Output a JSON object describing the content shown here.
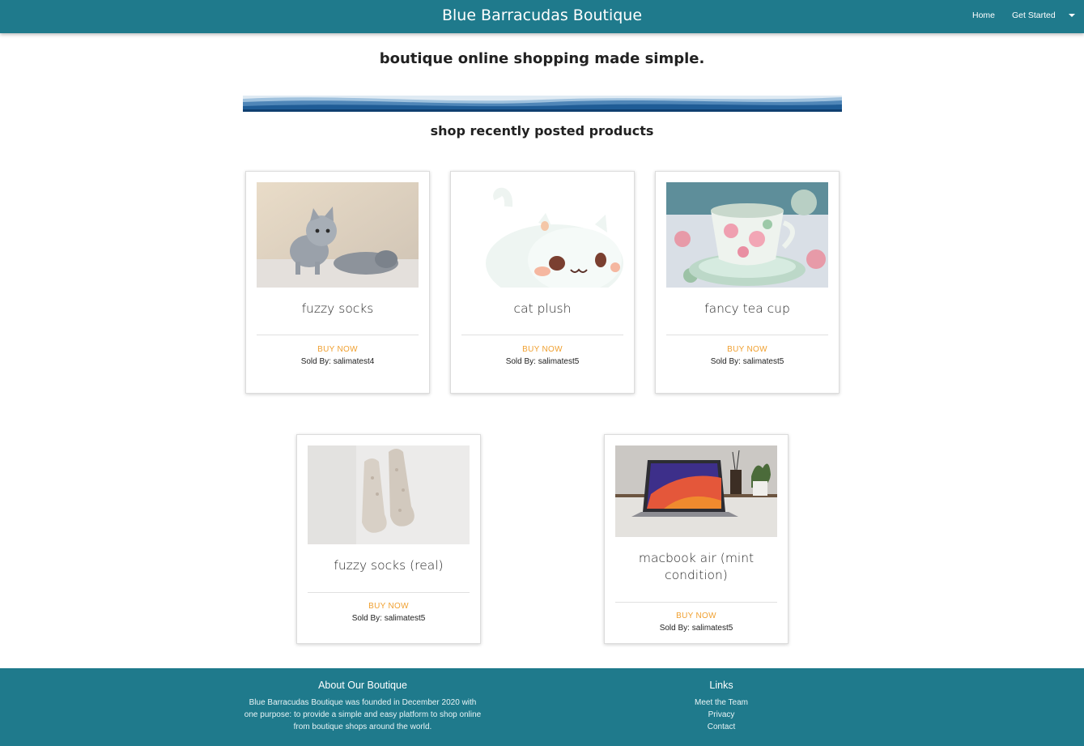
{
  "navbar": {
    "brand": "Blue Barracudas Boutique",
    "home_label": "Home",
    "get_started_label": "Get Started",
    "color": "#1f7a8c"
  },
  "hero": {
    "tagline": "boutique online shopping made simple.",
    "section_title": "shop recently posted products"
  },
  "products": [
    {
      "title": "fuzzy socks",
      "buy_label": "BUY NOW",
      "seller": "Sold By: salimatest4",
      "image": "kittens-photo"
    },
    {
      "title": "cat plush",
      "buy_label": "BUY NOW",
      "seller": "Sold By: salimatest5",
      "image": "cat-plush-photo"
    },
    {
      "title": "fancy tea cup",
      "buy_label": "BUY NOW",
      "seller": "Sold By: salimatest5",
      "image": "teacup-photo"
    },
    {
      "title": "fuzzy socks (real)",
      "buy_label": "BUY NOW",
      "seller": "Sold By: salimatest5",
      "image": "socks-photo"
    },
    {
      "title": "macbook air (mint condition)",
      "buy_label": "BUY NOW",
      "seller": "Sold By: salimatest5",
      "image": "laptop-photo"
    }
  ],
  "footer": {
    "about_title": "About Our Boutique",
    "about_text": "Blue Barracudas Boutique was founded in December 2020 with one purpose: to provide a simple and easy platform to shop online from boutique shops around the world.",
    "links_title": "Links",
    "links": [
      "Meet the Team",
      "Privacy",
      "Contact"
    ]
  },
  "colors": {
    "accent": "#f0a030",
    "footer_bg": "#1f7a8c"
  }
}
